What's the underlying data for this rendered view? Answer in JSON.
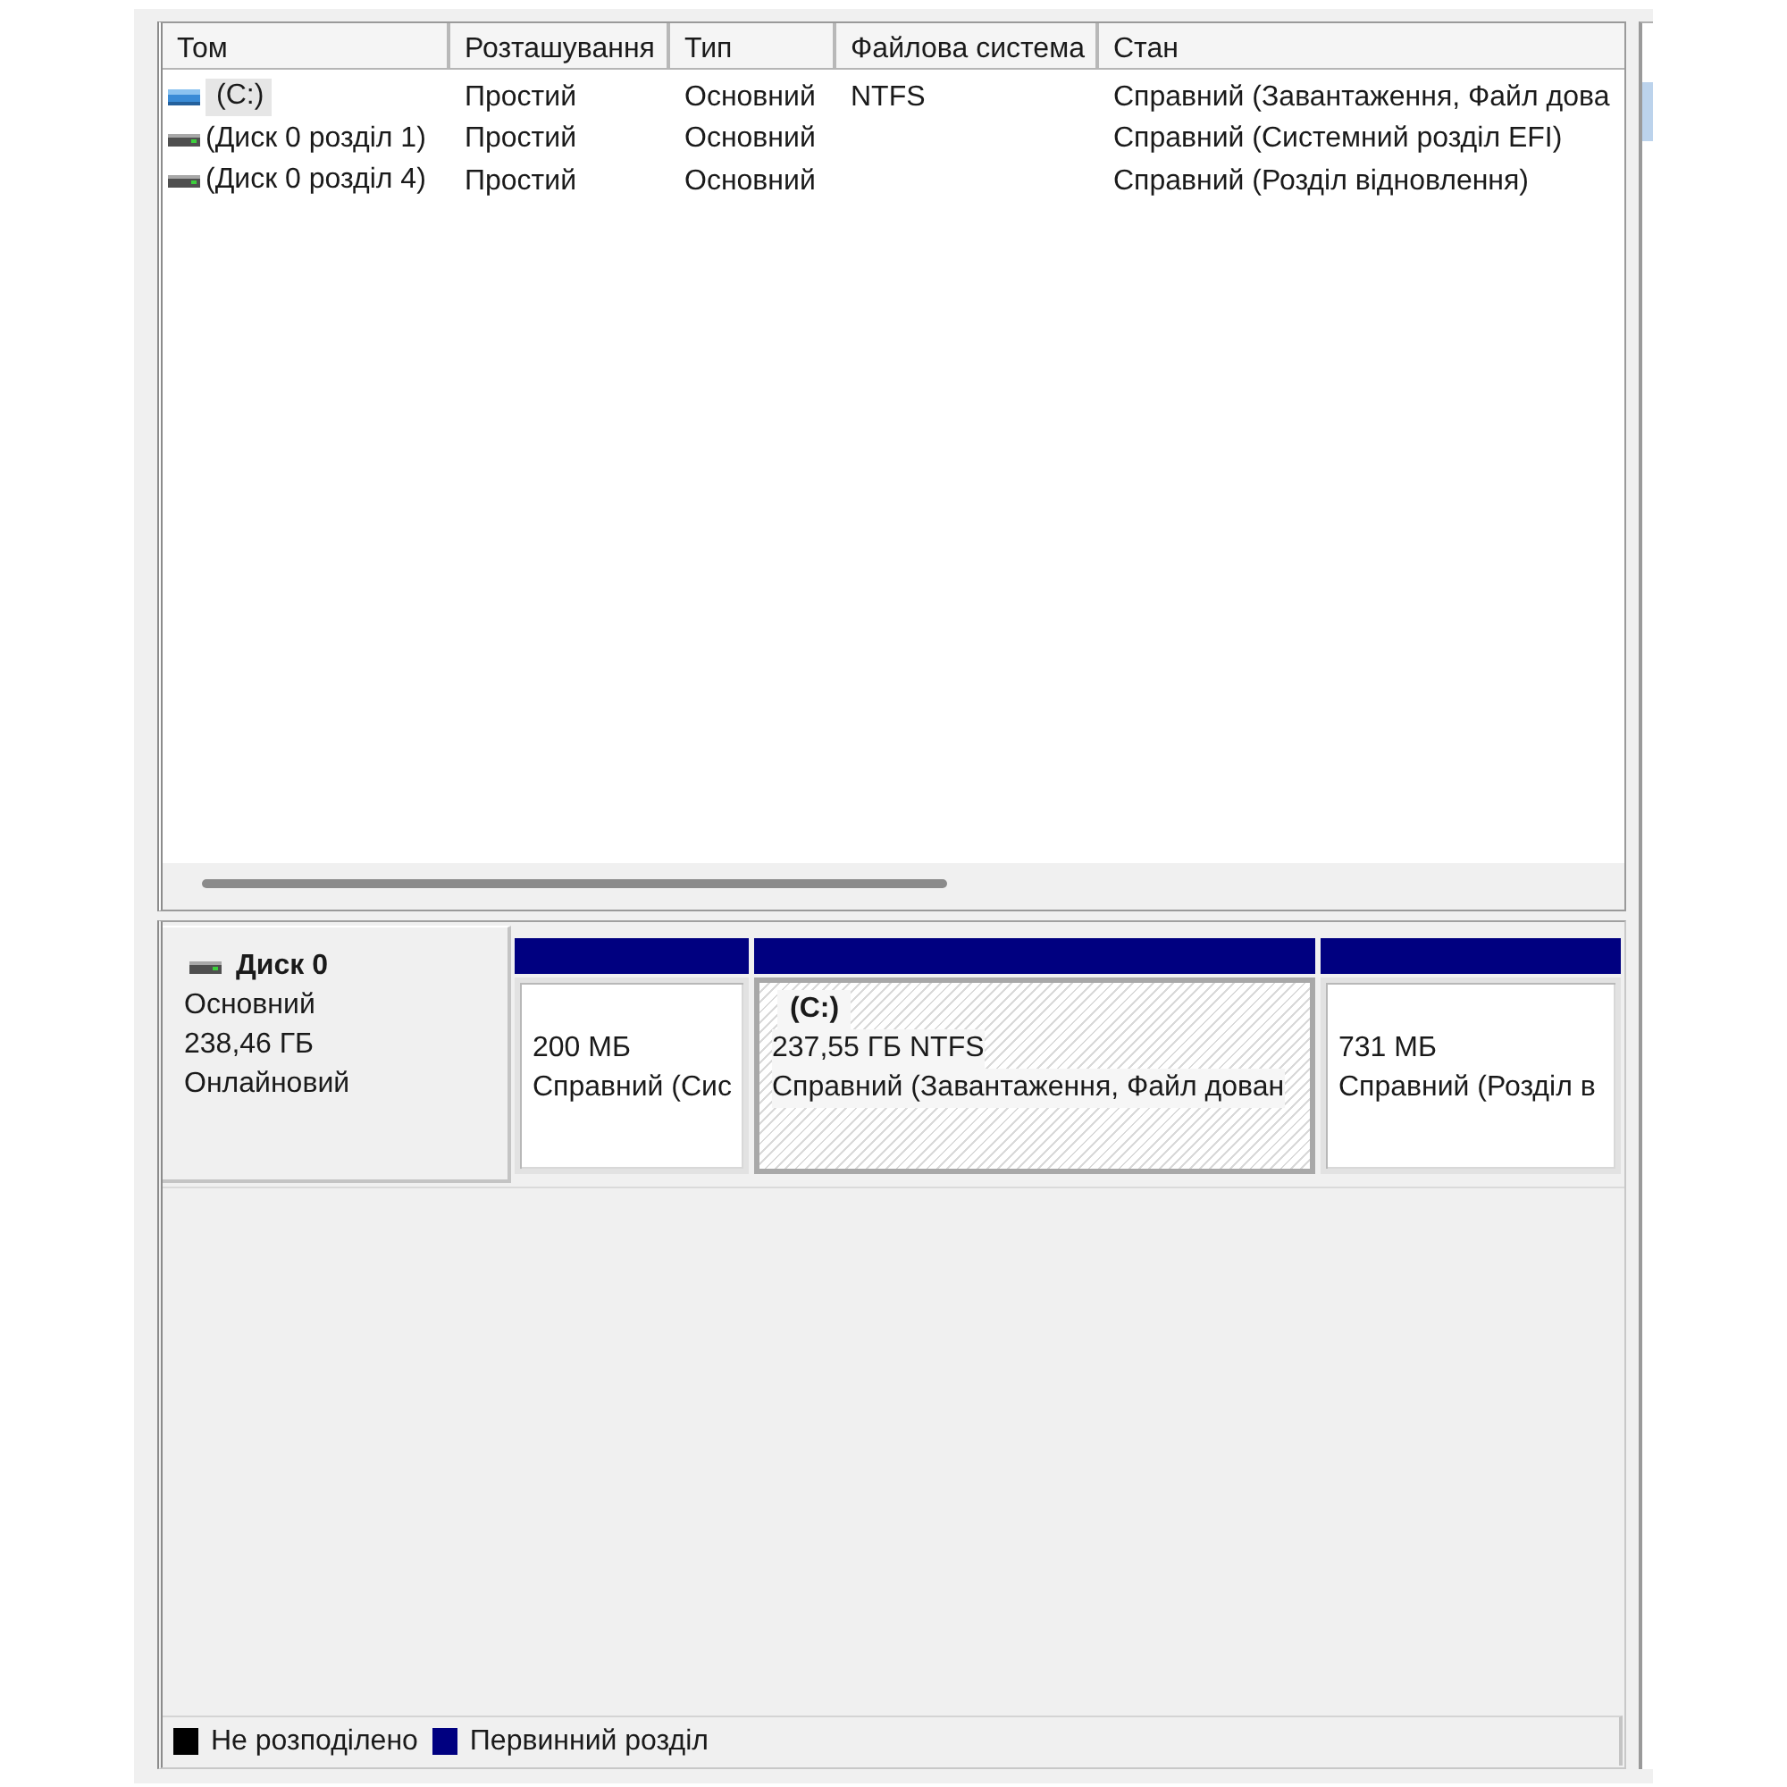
{
  "volume_list": {
    "columns": [
      "Том",
      "Розташування",
      "Тип",
      "Файлова система",
      "Стан"
    ],
    "rows": [
      {
        "kind": "system",
        "selected": true,
        "volume": "(C:)",
        "layout": "Простий",
        "type": "Основний",
        "file_system": "NTFS",
        "status": "Справний (Завантаження, Файл дова"
      },
      {
        "kind": "partition",
        "selected": false,
        "volume": "(Диск 0 розділ 1)",
        "layout": "Простий",
        "type": "Основний",
        "status": "Справний (Системний розділ EFI)"
      },
      {
        "kind": "partition",
        "selected": false,
        "volume": "(Диск 0 розділ 4)",
        "layout": "Простий",
        "type": "Основний",
        "status": "Справний (Розділ відновлення)"
      }
    ]
  },
  "disks": [
    {
      "name": "Диск 0",
      "type": "Основний",
      "size": "238,46 ГБ",
      "status": "Онлайновий",
      "partitions": [
        {
          "kind": "primary",
          "selected": false,
          "size": "200 МБ",
          "status": "Справний (Сис"
        },
        {
          "kind": "primary",
          "selected": true,
          "label": "(C:)",
          "size": "237,55 ГБ NTFS",
          "status": "Справний (Завантаження, Файл дован"
        },
        {
          "kind": "primary",
          "selected": false,
          "size": "731 МБ",
          "status": "Справний (Розділ в"
        }
      ]
    }
  ],
  "legend": [
    {
      "label": "Не розподілено",
      "color": "#000000"
    },
    {
      "label": "Первинний розділ",
      "color": "#000080"
    }
  ]
}
